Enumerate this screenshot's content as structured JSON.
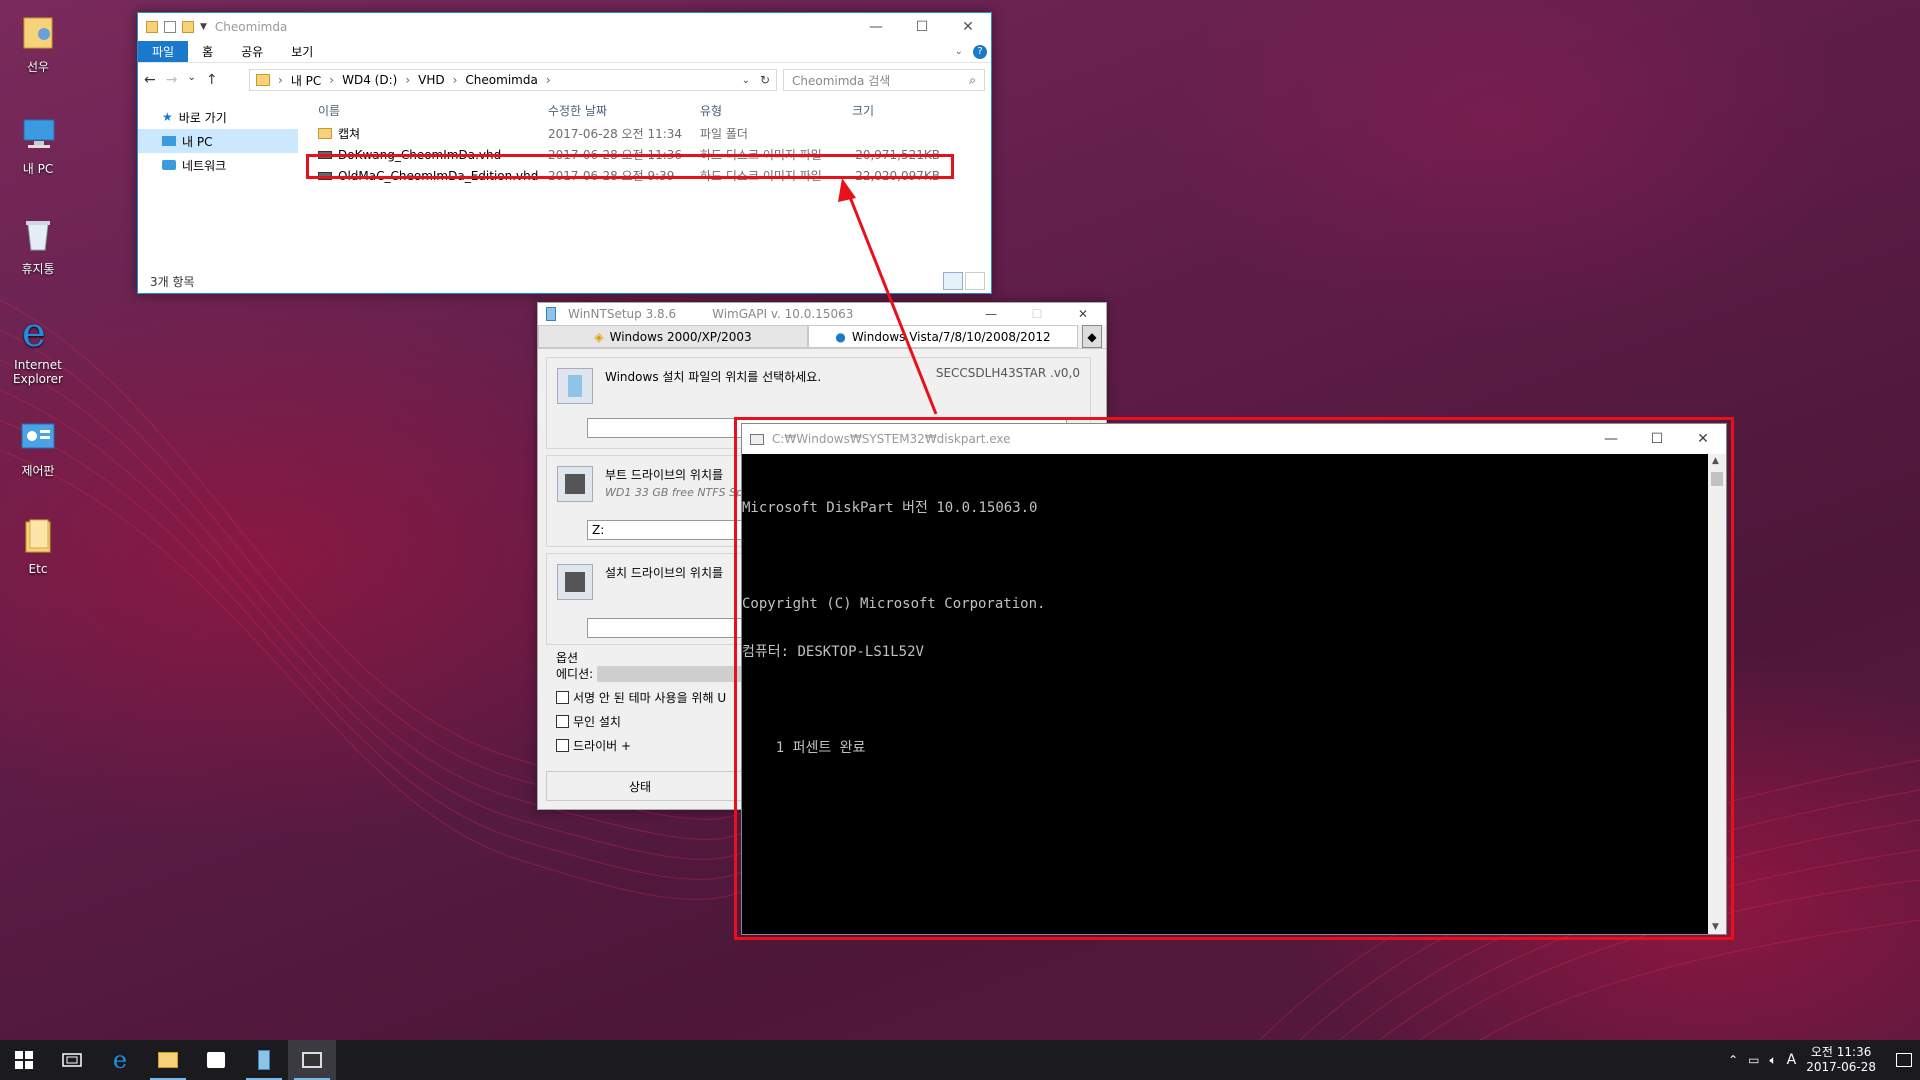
{
  "desktop": {
    "icons": [
      {
        "label": "선우",
        "icon": "user-folder-icon"
      },
      {
        "label": "내 PC",
        "icon": "this-pc-icon"
      },
      {
        "label": "휴지통",
        "icon": "recycle-bin-icon"
      },
      {
        "label": "Internet Explorer",
        "icon": "internet-explorer-icon"
      },
      {
        "label": "제어판",
        "icon": "control-panel-icon"
      },
      {
        "label": "Etc",
        "icon": "folder-icon"
      }
    ]
  },
  "explorer": {
    "title": "Cheomimda",
    "ribbon_tabs": [
      "파일",
      "홈",
      "공유",
      "보기"
    ],
    "breadcrumb": [
      "내 PC",
      "WD4 (D:)",
      "VHD",
      "Cheomimda"
    ],
    "search_placeholder": "Cheomimda 검색",
    "nav": [
      {
        "label": "바로 가기",
        "icon": "star-icon"
      },
      {
        "label": "내 PC",
        "icon": "computer-icon"
      },
      {
        "label": "네트워크",
        "icon": "network-icon"
      }
    ],
    "columns": [
      "이름",
      "수정한 날짜",
      "유형",
      "크기"
    ],
    "rows": [
      {
        "name": "캡쳐",
        "date": "2017-06-28 오전 11:34",
        "type": "파일 폴더",
        "size": "",
        "icon": "folder-icon"
      },
      {
        "name": "DoKwang_CheomImDa.vhd",
        "date": "2017-06-28 오전 11:36",
        "type": "하드 디스크 이미지 파일",
        "size": "20,971,521KB",
        "icon": "vhd-icon"
      },
      {
        "name": "OldMaC_CheomImDa_Edition.vhd",
        "date": "2017-06-28 오전 9:39",
        "type": "하드 디스크 이미지 파일",
        "size": "22,020,097KB",
        "icon": "vhd-icon"
      }
    ],
    "status": "3개 항목"
  },
  "winnt": {
    "title": "WinNTSetup 3.8.6",
    "wimgapi": "WimGAPI v. 10.0.15063",
    "tabs": [
      "Windows 2000/XP/2003",
      "Windows Vista/7/8/10/2008/2012"
    ],
    "source_label": "Windows 설치 파일의 위치를 선택하세요.",
    "source_right": "SECCSDLH43STAR .v0,0",
    "boot_label": "부트 드라이브의 위치를",
    "boot_sub": "WD1 33 GB free NTFS Sp",
    "boot_value": "Z:",
    "install_label": "설치 드라이브의 위치를",
    "options_label": "옵션",
    "edition_label": "에디션:",
    "opt_unsigned": "서명 안 된 테마 사용을 위해 U",
    "opt_unattended": "무인 설치",
    "opt_driver": "드라이버 +",
    "status_label": "상태"
  },
  "console": {
    "title": "C:₩Windows₩SYSTEM32₩diskpart.exe",
    "lines": [
      "Microsoft DiskPart 버전 10.0.15063.0",
      "",
      "Copyright (C) Microsoft Corporation.",
      "컴퓨터: DESKTOP-LS1L52V",
      "",
      "    1 퍼센트 완료"
    ]
  },
  "taskbar": {
    "apps": [
      "start-icon",
      "task-view-icon",
      "edge-icon",
      "file-explorer-icon",
      "store-icon",
      "winntsetup-icon",
      "console-icon"
    ],
    "clock_time": "오전 11:36",
    "clock_date": "2017-06-28",
    "ime": "A"
  },
  "colors": {
    "highlight": "#e8101a",
    "accent": "#1979ca",
    "taskbar": "#1a1a1f"
  }
}
